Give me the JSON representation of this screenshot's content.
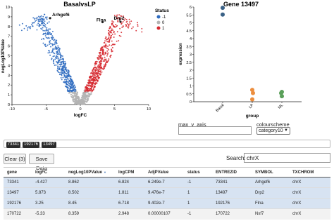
{
  "volcano": {
    "title": "BasalvsLP",
    "xlabel": "logFC",
    "ylabel": "negLog10PValue",
    "legend_title": "Status",
    "legend_items": [
      {
        "label": "-1",
        "color": "#2f6cc0"
      },
      {
        "label": "0",
        "color": "#b4b4b4"
      },
      {
        "label": "1",
        "color": "#d62930"
      }
    ],
    "annotations": [
      "Arhgef6",
      "Flna",
      "Drp2"
    ]
  },
  "strip": {
    "title": "Gene 13497",
    "ylabel": "expression",
    "xlabel": "group"
  },
  "chart_data": [
    {
      "type": "scatter",
      "title": "BasalvsLP",
      "xlabel": "logFC",
      "ylabel": "negLog10PValue",
      "xlim": [
        -10,
        10
      ],
      "ylim": [
        0,
        10
      ],
      "x_ticks": [
        "-10",
        "-5",
        "0",
        "5",
        "10"
      ],
      "y_ticks": [
        "0",
        "1",
        "2",
        "3",
        "4",
        "5",
        "6",
        "7",
        "8",
        "9",
        "10"
      ],
      "legend": {
        "title": "Status",
        "placement": "top-right",
        "entries": [
          "-1",
          "0",
          "1"
        ]
      },
      "highlighted_points": [
        {
          "label": "Arhgef6",
          "x": -4.427,
          "y": 8.862
        },
        {
          "label": "Flna",
          "x": 3.25,
          "y": 8.45
        },
        {
          "label": "Drp2",
          "x": 5.873,
          "y": 8.502
        }
      ]
    },
    {
      "type": "scatter",
      "title": "Gene 13497",
      "xlabel": "group",
      "ylabel": "expression",
      "ylim": [
        0,
        6
      ],
      "y_ticks": [
        "0",
        "0.5",
        "1",
        "1.5",
        "2",
        "2.5",
        "3",
        "3.5",
        "4",
        "4.5",
        "5",
        "5.5",
        "6"
      ],
      "categories": [
        "Basal",
        "LP",
        "ML"
      ],
      "series": [
        {
          "category": "Basal",
          "color": "#3a6186",
          "values": [
            5.95,
            5.52
          ]
        },
        {
          "category": "LP",
          "color": "#ec8e3e",
          "values": [
            0.75,
            0.55,
            0.15
          ]
        },
        {
          "category": "ML",
          "color": "#5aa05a",
          "values": [
            0.62,
            0.55,
            0.35
          ]
        }
      ]
    }
  ],
  "controls": {
    "max_y_label": "max_y_axis",
    "max_y_value": "",
    "colourscheme_label": "colourscheme",
    "colourscheme_value": "category10"
  },
  "selected_tags": [
    "73341",
    "192176",
    "13497"
  ],
  "buttons": {
    "clear": "Clear (3)",
    "save": "Save Data"
  },
  "search": {
    "label": "Search:",
    "value": "chrX"
  },
  "table": {
    "headers": [
      "gene",
      "logFC",
      "negLog10PValue",
      "logCPM",
      "AdjPValue",
      "status",
      "ENTREZID",
      "SYMBOL",
      "TXCHROM"
    ],
    "rows": [
      [
        "73341",
        "-4.427",
        "8.862",
        "6.824",
        "6.249e-7",
        "-1",
        "73341",
        "Arhgef6",
        "chrX"
      ],
      [
        "13497",
        "5.873",
        "8.502",
        "1.811",
        "9.476e-7",
        "1",
        "13497",
        "Drp2",
        "chrX"
      ],
      [
        "192176",
        "3.25",
        "8.45",
        "6.718",
        "9.402e-7",
        "1",
        "192176",
        "Flna",
        "chrX"
      ],
      [
        "170722",
        "-5.33",
        "8.359",
        "2.948",
        "0.00000107",
        "-1",
        "170722",
        "Nxf7",
        "chrX"
      ]
    ]
  }
}
